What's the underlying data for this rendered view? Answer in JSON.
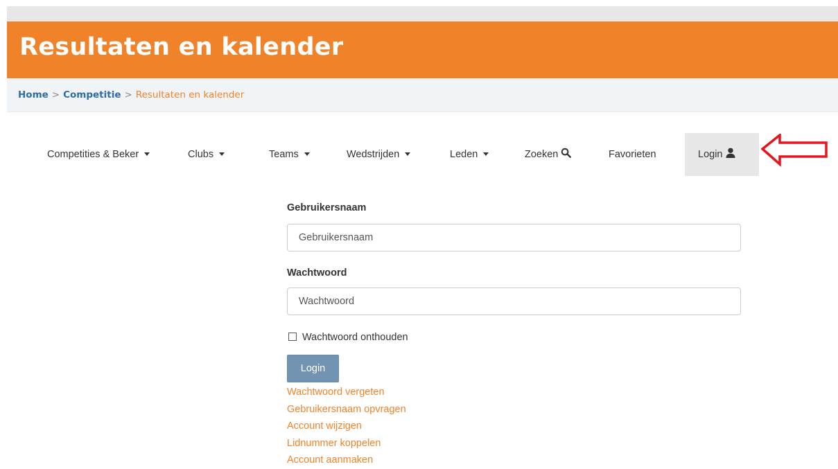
{
  "header": {
    "title": "Resultaten en kalender"
  },
  "breadcrumb": {
    "items": [
      "Home",
      "Competitie"
    ],
    "separator": ">",
    "current": "Resultaten en kalender"
  },
  "nav": {
    "items": [
      {
        "label": "Competities & Beker",
        "dropdown": true
      },
      {
        "label": "Clubs",
        "dropdown": true
      },
      {
        "label": "Teams",
        "dropdown": true
      },
      {
        "label": "Wedstrijden",
        "dropdown": true
      },
      {
        "label": "Leden",
        "dropdown": true
      },
      {
        "label": "Zoeken",
        "icon": "search-icon"
      },
      {
        "label": "Favorieten"
      },
      {
        "label": "Login",
        "icon": "user-icon",
        "active": true
      }
    ]
  },
  "form": {
    "username_label": "Gebruikersnaam",
    "username_placeholder": "Gebruikersnaam",
    "password_label": "Wachtwoord",
    "password_placeholder": "Wachtwoord",
    "remember_label": "Wachtwoord onthouden",
    "remember_checked": false,
    "login_button": "Login"
  },
  "links": [
    "Wachtwoord vergeten",
    "Gebruikersnaam opvragen",
    "Account wijzigen",
    "Lidnummer koppelen",
    "Account aanmaken"
  ],
  "colors": {
    "brand_orange": "#f0832a",
    "breadcrumb_link": "#2e6da4",
    "button_blue": "#7393b3",
    "annotation_arrow": "#e8141c"
  }
}
